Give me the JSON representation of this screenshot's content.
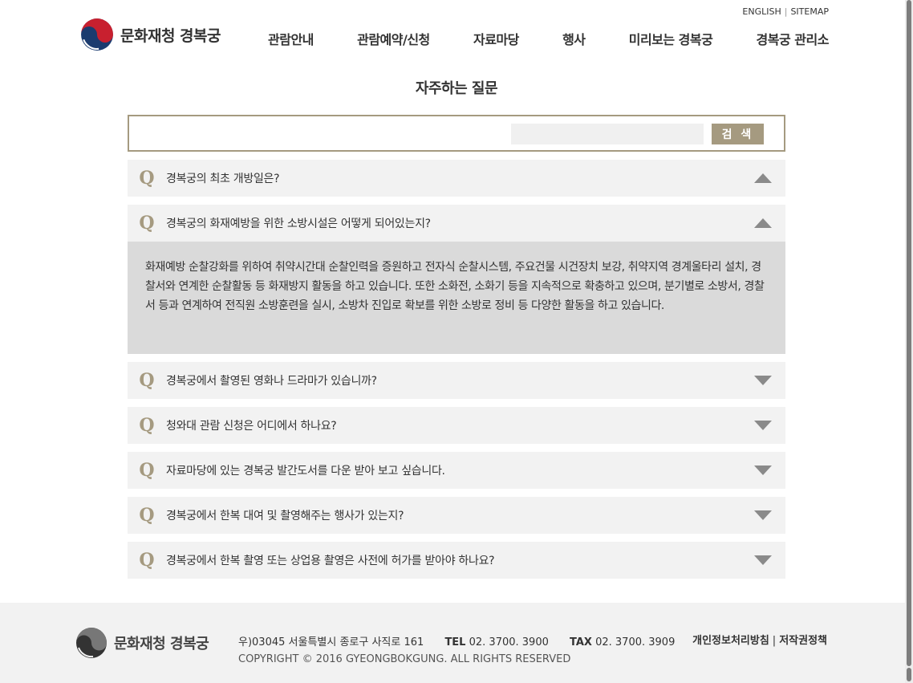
{
  "header": {
    "util_links": [
      "ENGLISH",
      "SITEMAP"
    ],
    "logo_text": "문화재청 경복궁",
    "nav": [
      "관람안내",
      "관람예약/신청",
      "자료마당",
      "행사",
      "미리보는 경복궁",
      "경복궁 관리소"
    ]
  },
  "page_title": "자주하는 질문",
  "search": {
    "placeholder": "",
    "button_label": "검 색"
  },
  "faq": [
    {
      "q": "Q",
      "question": "경복궁의 최초 개방일은?",
      "state": "collapsed-up"
    },
    {
      "q": "Q",
      "question": "경복궁의 화재예방을 위한 소방시설은 어떻게 되어있는지?",
      "state": "expanded",
      "answer": "화재예방 순찰강화를 위하여 취약시간대 순찰인력을 증원하고 전자식 순찰시스템, 주요건물 시건장치 보강, 취약지역 경계울타리 설치, 경찰서와 연계한 순찰활동 등 화재방지 활동을 하고 있습니다. 또한 소화전, 소화기 등을 지속적으로 확충하고 있으며, 분기별로 소방서, 경찰서 등과 연계하여 전직원 소방훈련을 실시, 소방차 진입로 확보를 위한 소방로 정비 등 다양한 활동을 하고 있습니다."
    },
    {
      "q": "Q",
      "question": "경복궁에서 촬영된 영화나 드라마가 있습니까?",
      "state": "collapsed"
    },
    {
      "q": "Q",
      "question": "청와대 관람 신청은 어디에서 하나요?",
      "state": "collapsed"
    },
    {
      "q": "Q",
      "question": "자료마당에 있는 경복궁 발간도서를 다운 받아 보고 싶습니다.",
      "state": "collapsed"
    },
    {
      "q": "Q",
      "question": "경복궁에서 한복 대여 및 촬영해주는 행사가 있는지?",
      "state": "collapsed"
    },
    {
      "q": "Q",
      "question": "경복궁에서 한복 촬영 또는 상업용 촬영은 사전에 허가를 받아야 하나요?",
      "state": "collapsed"
    }
  ],
  "footer": {
    "logo_text": "문화재청 경복궁",
    "address": "우)03045 서울특별시 종로구 사직로 161",
    "tel_label": "TEL",
    "tel": "02. 3700. 3900",
    "fax_label": "TAX",
    "fax": "02. 3700. 3909",
    "copyright": "COPYRIGHT © 2016 GYEONGBOKGUNG. ALL RIGHTS RESERVED",
    "links": [
      "개인정보처리방침",
      "저작권정책"
    ]
  },
  "colors": {
    "accent": "#a59a80",
    "faq_bg": "#f2f2f2",
    "answer_bg": "#dadada",
    "arrow": "#8a8a8a"
  }
}
